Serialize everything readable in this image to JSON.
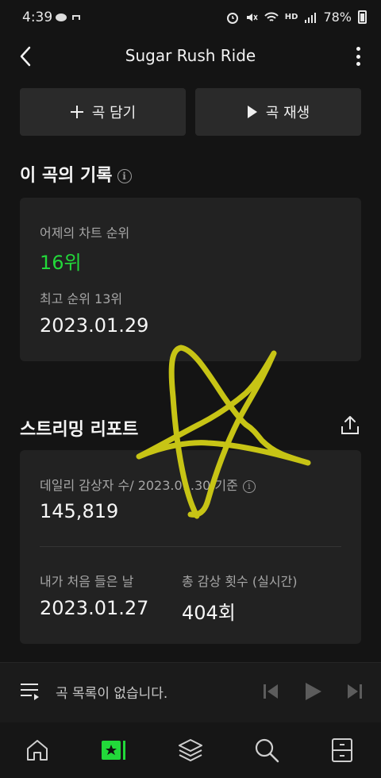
{
  "status_bar": {
    "time": "4:39",
    "battery": "78%",
    "network": "HD"
  },
  "header": {
    "title": "Sugar Rush Ride"
  },
  "actions": {
    "add_label": "곡 담기",
    "play_label": "곡 재생"
  },
  "record_section": {
    "title": "이 곡의 기록",
    "yesterday_rank_label": "어제의 차트 순위",
    "yesterday_rank_value": "16위",
    "best_rank_label": "최고 순위 13위",
    "best_rank_date": "2023.01.29"
  },
  "report_section": {
    "title": "스트리밍 리포트",
    "daily_listeners_label": "데일리 감상자 수/ 2023.01.30 기준",
    "daily_listeners_value": "145,819",
    "first_listen_label": "내가 처음 들은 날",
    "first_listen_value": "2023.01.27",
    "total_plays_label": "총 감상 횟수 (실시간)",
    "total_plays_value": "404회"
  },
  "player": {
    "empty_text": "곡 목록이 없습니다."
  },
  "nav": {
    "items": [
      "home-icon",
      "music-icon",
      "library-icon",
      "search-icon",
      "drawer-icon"
    ],
    "accent": "#22d93a"
  },
  "colors": {
    "background": "#141414",
    "card": "#222222",
    "accent_green": "#22d93a",
    "doodle": "#c7c415"
  }
}
